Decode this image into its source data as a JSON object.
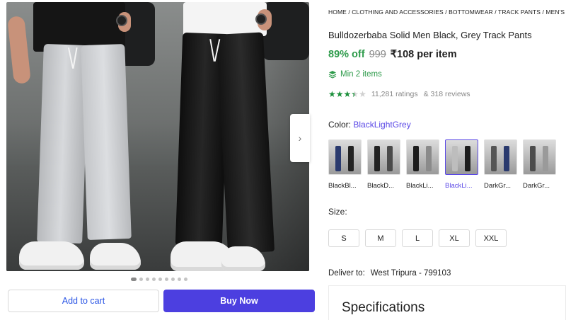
{
  "gallery": {
    "next_arrow": "›",
    "dots_count": 9,
    "active_dot": 0
  },
  "actions": {
    "add_to_cart": "Add to cart",
    "buy_now": "Buy Now"
  },
  "product": {
    "breadcrumb": "HOME / CLOTHING AND ACCESSORIES / BOTTOMWEAR / TRACK PANTS / MEN'S TRACK P",
    "title": "Bulldozerbaba Solid Men Black, Grey Track Pants",
    "discount": "89% off",
    "mrp": "999",
    "price": "₹108 per item",
    "min_items": "Min 2 items",
    "rating_stars": 3.5,
    "ratings_text": "11,281 ratings",
    "reviews_text": "& 318 reviews"
  },
  "color": {
    "label": "Color:",
    "selected_value": "BlackLightGrey",
    "options": [
      {
        "label": "BlackBl...",
        "legs": [
          "#2a3a6e",
          "#222222"
        ]
      },
      {
        "label": "BlackD...",
        "legs": [
          "#222222",
          "#4a4a4a"
        ]
      },
      {
        "label": "BlackLi...",
        "legs": [
          "#1c1c1c",
          "#8a8a8a"
        ]
      },
      {
        "label": "BlackLi...",
        "legs": [
          "#bdbdbd",
          "#1c1c1c"
        ],
        "selected": true
      },
      {
        "label": "DarkGr...",
        "legs": [
          "#555555",
          "#2a3a6e"
        ]
      },
      {
        "label": "DarkGr...",
        "legs": [
          "#4c4c4c",
          "#9a9a9a"
        ]
      }
    ]
  },
  "size": {
    "label": "Size:",
    "options": [
      "S",
      "M",
      "L",
      "XL",
      "XXL"
    ]
  },
  "delivery": {
    "label": "Deliver to:",
    "value": "West Tripura - 799103"
  },
  "specifications": {
    "title": "Specifications"
  },
  "colors": {
    "accent": "#4c3fe0",
    "discount_green": "#2e9b4b",
    "star_green": "#1a8f3a"
  }
}
